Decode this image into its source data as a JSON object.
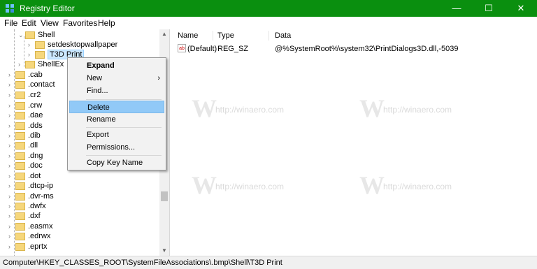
{
  "window": {
    "title": "Registry Editor",
    "minimize": "—",
    "maximize": "☐",
    "close": "✕"
  },
  "menu": [
    "File",
    "Edit",
    "View",
    "Favorites",
    "Help"
  ],
  "tree": {
    "shell": "Shell",
    "children": [
      "setdesktopwallpaper",
      "T3D Print"
    ],
    "shellex": "ShellEx",
    "extensions": [
      ".cab",
      ".contact",
      ".cr2",
      ".crw",
      ".dae",
      ".dds",
      ".dib",
      ".dll",
      ".dng",
      ".doc",
      ".dot",
      ".dtcp-ip",
      ".dvr-ms",
      ".dwfx",
      ".dxf",
      ".easmx",
      ".edrwx",
      ".eprtx"
    ]
  },
  "list": {
    "columns": [
      "Name",
      "Type",
      "Data"
    ],
    "rows": [
      {
        "name": "(Default)",
        "type": "REG_SZ",
        "data": "@%SystemRoot%\\system32\\PrintDialogs3D.dll,-5039"
      }
    ]
  },
  "context_menu": [
    "Expand",
    "New",
    "Find...",
    "Delete",
    "Rename",
    "Export",
    "Permissions...",
    "Copy Key Name"
  ],
  "status": "Computer\\HKEY_CLASSES_ROOT\\SystemFileAssociations\\.bmp\\Shell\\T3D Print",
  "watermark": "http://winaero.com"
}
